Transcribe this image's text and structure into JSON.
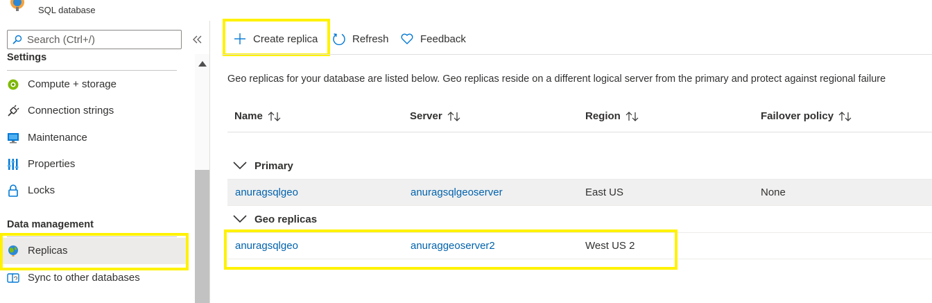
{
  "header": {
    "resource_type": "SQL database"
  },
  "sidebar": {
    "search_placeholder": "Search (Ctrl+/)",
    "sections": {
      "settings": "Settings",
      "data_management": "Data management"
    },
    "items": [
      {
        "label": "Compute + storage",
        "icon": "compute-storage-icon"
      },
      {
        "label": "Connection strings",
        "icon": "connection-plug-icon"
      },
      {
        "label": "Maintenance",
        "icon": "monitor-maintenance-icon"
      },
      {
        "label": "Properties",
        "icon": "properties-bars-icon"
      },
      {
        "label": "Locks",
        "icon": "lock-icon"
      },
      {
        "label": "Replicas",
        "icon": "globe-icon",
        "selected": true
      },
      {
        "label": "Sync to other databases",
        "icon": "sync-icon"
      }
    ]
  },
  "toolbar": {
    "create_replica": "Create replica",
    "refresh": "Refresh",
    "feedback": "Feedback"
  },
  "main": {
    "description": "Geo replicas for your database are listed below. Geo replicas reside on a different logical server from the primary and protect against regional failure"
  },
  "grid": {
    "columns": [
      "Name",
      "Server",
      "Region",
      "Failover policy"
    ],
    "groups": [
      {
        "label": "Primary",
        "rows": [
          {
            "name": "anuragsqlgeo",
            "server": "anuragsqlgeoserver",
            "region": "East US",
            "failover_policy": "None"
          }
        ]
      },
      {
        "label": "Geo replicas",
        "rows": [
          {
            "name": "anuragsqlgeo",
            "server": "anuraggeoserver2",
            "region": "West US 2",
            "failover_policy": ""
          }
        ]
      }
    ]
  },
  "colors": {
    "link": "#0062ad",
    "highlight": "#fff200",
    "selected_bg": "#edebe9",
    "accent_blue": "#0078d4"
  }
}
